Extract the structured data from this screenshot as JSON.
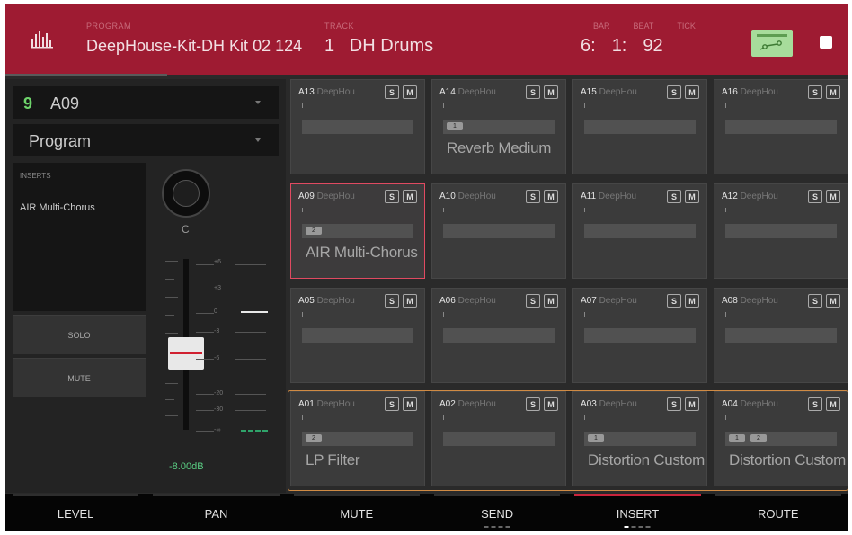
{
  "header": {
    "program_caption": "PROGRAM",
    "program_name": "DeepHouse-Kit-DH Kit 02 124",
    "track_caption": "TRACK",
    "track_number": "1",
    "track_name": "DH Drums",
    "position": {
      "bar_caption": "BAR",
      "beat_caption": "BEAT",
      "tick_caption": "TICK",
      "bar": "6:",
      "beat": "1:",
      "tick": "92"
    }
  },
  "left_panel": {
    "pad_number": "9",
    "pad_name": "A09",
    "type": "Program",
    "inserts_caption": "INSERTS",
    "insert_item": "AIR Multi-Chorus",
    "solo_label": "SOLO",
    "mute_label": "MUTE",
    "pan_value": "C",
    "scale": [
      "+6",
      "+3",
      "0",
      "-3",
      "-6",
      "-20",
      "-30",
      "-∞"
    ],
    "level_value": "-8.00dB"
  },
  "pads": [
    {
      "id": "A13",
      "sub": "DeepHou",
      "fx": "",
      "slots": []
    },
    {
      "id": "A14",
      "sub": "DeepHou",
      "fx": "Reverb Medium",
      "slots": [
        "1"
      ]
    },
    {
      "id": "A15",
      "sub": "DeepHou",
      "fx": "",
      "slots": []
    },
    {
      "id": "A16",
      "sub": "DeepHou",
      "fx": "",
      "slots": []
    },
    {
      "id": "A09",
      "sub": "DeepHou",
      "fx": "AIR Multi-Chorus",
      "slots": [
        "2"
      ],
      "selected": true
    },
    {
      "id": "A10",
      "sub": "DeepHou",
      "fx": "",
      "slots": []
    },
    {
      "id": "A11",
      "sub": "DeepHou",
      "fx": "",
      "slots": []
    },
    {
      "id": "A12",
      "sub": "DeepHou",
      "fx": "",
      "slots": []
    },
    {
      "id": "A05",
      "sub": "DeepHou",
      "fx": "",
      "slots": []
    },
    {
      "id": "A06",
      "sub": "DeepHou",
      "fx": "",
      "slots": []
    },
    {
      "id": "A07",
      "sub": "DeepHou",
      "fx": "",
      "slots": []
    },
    {
      "id": "A08",
      "sub": "DeepHou",
      "fx": "",
      "slots": []
    },
    {
      "id": "A01",
      "sub": "DeepHou",
      "fx": "LP Filter",
      "slots": [
        "2"
      ]
    },
    {
      "id": "A02",
      "sub": "DeepHou",
      "fx": "",
      "slots": []
    },
    {
      "id": "A03",
      "sub": "DeepHou",
      "fx": "Distortion Custom",
      "slots": [
        "1"
      ]
    },
    {
      "id": "A04",
      "sub": "DeepHou",
      "fx": "Distortion Custom",
      "slots": [
        "1",
        "2"
      ]
    }
  ],
  "pad_solo_label": "S",
  "pad_mute_label": "M",
  "tabs": [
    {
      "label": "LEVEL"
    },
    {
      "label": "PAN"
    },
    {
      "label": "MUTE"
    },
    {
      "label": "SEND"
    },
    {
      "label": "INSERT",
      "active": true
    },
    {
      "label": "ROUTE"
    }
  ],
  "colors": {
    "header": "#9e1b32",
    "selected_pad_border": "#e04a61",
    "bank_outline": "#d08b44",
    "level_text": "#5bcf84",
    "route_button": "#a7dc9b"
  }
}
